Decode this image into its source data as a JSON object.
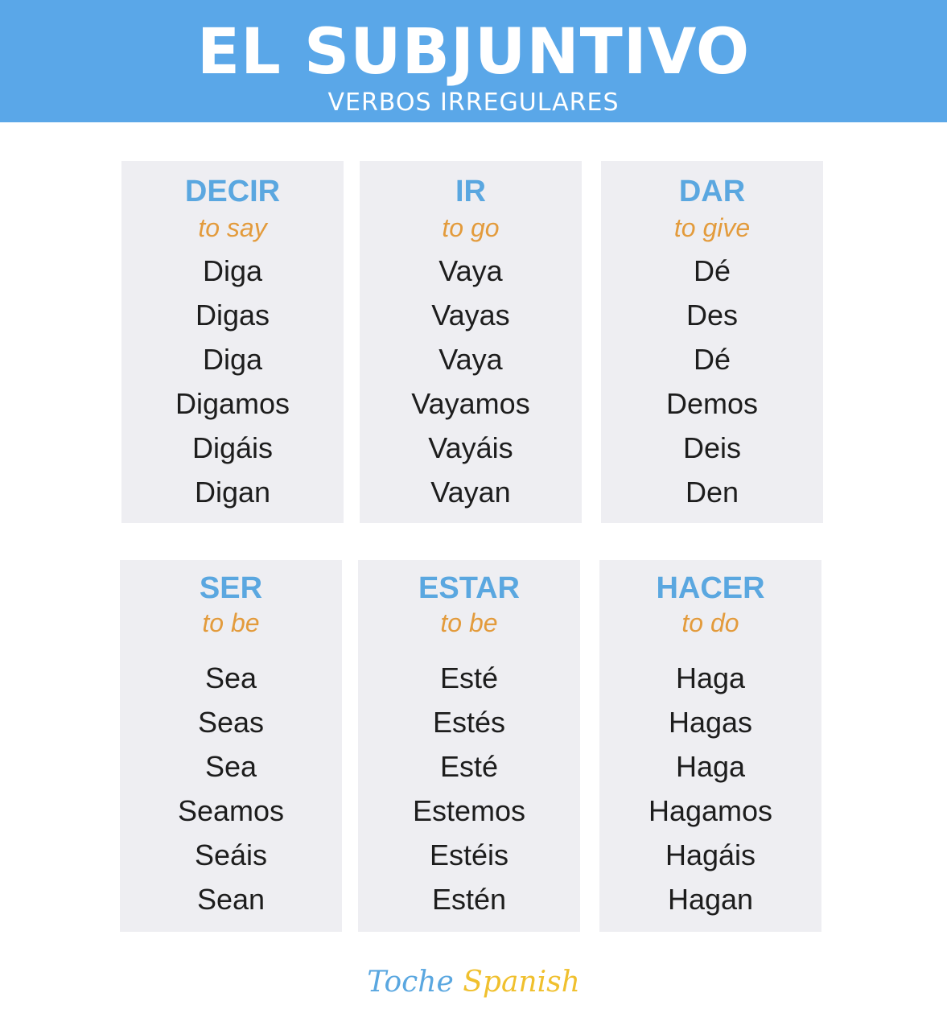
{
  "header": {
    "title": "EL SUBJUNTIVO",
    "subtitle": "VERBOS IRREGULARES"
  },
  "verbs": [
    {
      "verb": "DECIR",
      "meaning": "to say",
      "forms": [
        "Diga",
        "Digas",
        "Diga",
        "Digamos",
        "Digáis",
        "Digan"
      ]
    },
    {
      "verb": "IR",
      "meaning": "to go",
      "forms": [
        "Vaya",
        "Vayas",
        "Vaya",
        "Vayamos",
        "Vayáis",
        "Vayan"
      ]
    },
    {
      "verb": "DAR",
      "meaning": "to give",
      "forms": [
        "Dé",
        "Des",
        "Dé",
        "Demos",
        "Deis",
        "Den"
      ]
    },
    {
      "verb": "SER",
      "meaning": "to be",
      "forms": [
        "Sea",
        "Seas",
        "Sea",
        "Seamos",
        "Seáis",
        "Sean"
      ]
    },
    {
      "verb": "ESTAR",
      "meaning": "to be",
      "forms": [
        "Esté",
        "Estés",
        "Esté",
        "Estemos",
        "Estéis",
        "Estén"
      ]
    },
    {
      "verb": "HACER",
      "meaning": "to do",
      "forms": [
        "Haga",
        "Hagas",
        "Haga",
        "Hagamos",
        "Hagáis",
        "Hagan"
      ]
    }
  ],
  "brand": {
    "part1": "Toche",
    "part2": "Spanish"
  },
  "colors": {
    "header_bg": "#5aa7e8",
    "verb": "#5aa7e0",
    "meaning": "#e39b3c",
    "card_bg": "#eeeef2",
    "brand_accent": "#f0c02e"
  }
}
